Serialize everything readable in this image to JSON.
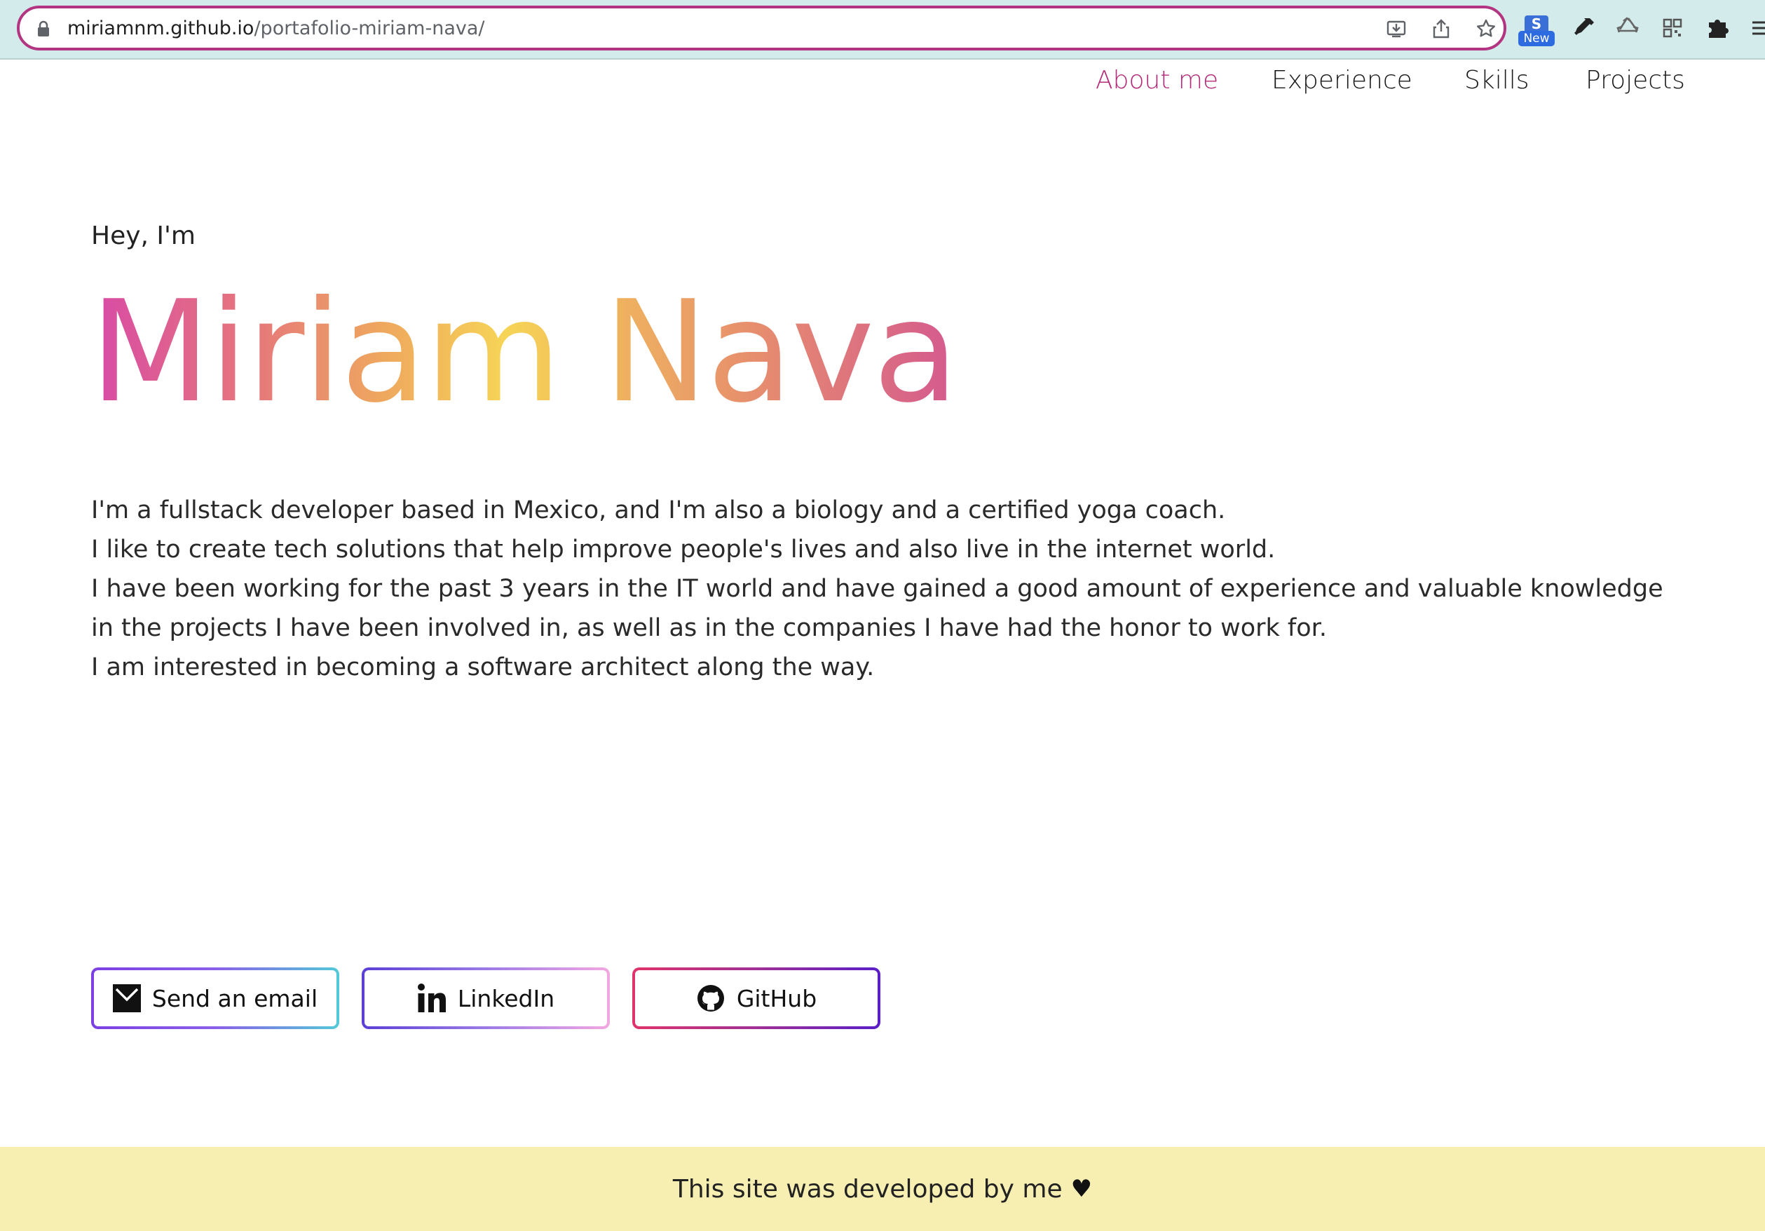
{
  "browser": {
    "url_host": "miriamnm.github.io",
    "url_path": "/portafolio-miriam-nava/",
    "extension_badge": "New",
    "extension_letter": "S",
    "accent_color": "#b33582",
    "toolbar_color": "#d4ebeb"
  },
  "nav": {
    "items": [
      {
        "label": "About me",
        "active": true
      },
      {
        "label": "Experience",
        "active": false
      },
      {
        "label": "Skills",
        "active": false
      },
      {
        "label": "Projects",
        "active": false
      }
    ],
    "active_color": "#b22a78"
  },
  "hero": {
    "greeting": "Hey, I'm",
    "name": "Miriam Nava",
    "bio": [
      "I'm a fullstack developer based in Mexico, and I'm also a biology and a certified yoga coach.",
      "I like to create tech solutions that help improve people's lives and also live in the internet world.",
      "I have been working for the past 3 years in the IT world and have gained a good amount of experience and valuable knowledge",
      "in the projects I have been involved in, as well as in the companies I have had the honor to work for.",
      "I am interested in becoming a software architect along the way."
    ]
  },
  "buttons": {
    "email": {
      "label": "Send an email",
      "icon": "envelope-icon"
    },
    "linkedin": {
      "label": "LinkedIn",
      "icon": "linkedin-icon"
    },
    "github": {
      "label": "GitHub",
      "icon": "github-icon"
    }
  },
  "footer": {
    "text": "This site was developed by me",
    "icon": "heart-icon",
    "background": "#f7efb2"
  }
}
